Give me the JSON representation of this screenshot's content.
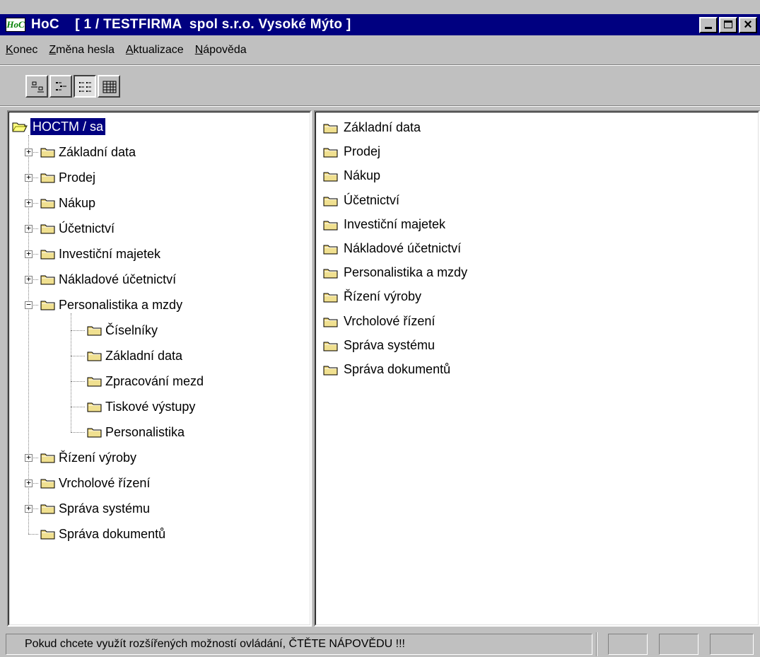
{
  "window": {
    "app_icon_text": "HoC",
    "title": "HoC    [ 1 / TESTFIRMA  spol s.r.o. Vysoké Mýto ]",
    "accent_color": "#000080"
  },
  "menu": [
    {
      "label": "Konec",
      "accel": "K"
    },
    {
      "label": "Změna hesla",
      "accel": "Z"
    },
    {
      "label": "Aktualizace",
      "accel": "A"
    },
    {
      "label": "Nápověda",
      "accel": "N"
    }
  ],
  "toolbar": {
    "buttons": [
      {
        "icon": "large-icons-view-icon",
        "pressed": false
      },
      {
        "icon": "small-icons-view-icon",
        "pressed": false
      },
      {
        "icon": "list-view-icon",
        "pressed": true
      },
      {
        "icon": "details-view-icon",
        "pressed": false
      }
    ]
  },
  "tree": {
    "root": {
      "label": "HOCTM / sa",
      "selected": true,
      "expanded": true
    },
    "items": [
      {
        "label": "Základní data",
        "expander": "+"
      },
      {
        "label": "Prodej",
        "expander": "+"
      },
      {
        "label": "Nákup",
        "expander": "+"
      },
      {
        "label": "Účetnictví",
        "expander": "+"
      },
      {
        "label": "Investiční majetek",
        "expander": "+"
      },
      {
        "label": "Nákladové účetnictví",
        "expander": "+"
      },
      {
        "label": "Personalistika a mzdy",
        "expander": "−",
        "children": [
          {
            "label": "Číselníky"
          },
          {
            "label": "Základní data"
          },
          {
            "label": "Zpracování mezd"
          },
          {
            "label": "Tiskové výstupy"
          },
          {
            "label": "Personalistika"
          }
        ]
      },
      {
        "label": "Řízení výroby",
        "expander": "+"
      },
      {
        "label": "Vrcholové řízení",
        "expander": "+"
      },
      {
        "label": "Správa systému",
        "expander": "+"
      },
      {
        "label": "Správa dokumentů",
        "expander": ""
      }
    ]
  },
  "list": {
    "items": [
      "Základní data",
      "Prodej",
      "Nákup",
      "Účetnictví",
      "Investiční majetek",
      "Nákladové účetnictví",
      "Personalistika a mzdy",
      "Řízení výroby",
      "Vrcholové řízení",
      "Správa systému",
      "Správa dokumentů"
    ]
  },
  "status": {
    "text": "Pokud chcete využít rozšířených možností ovládání, ČTĚTE NÁPOVĚDU !!!"
  }
}
